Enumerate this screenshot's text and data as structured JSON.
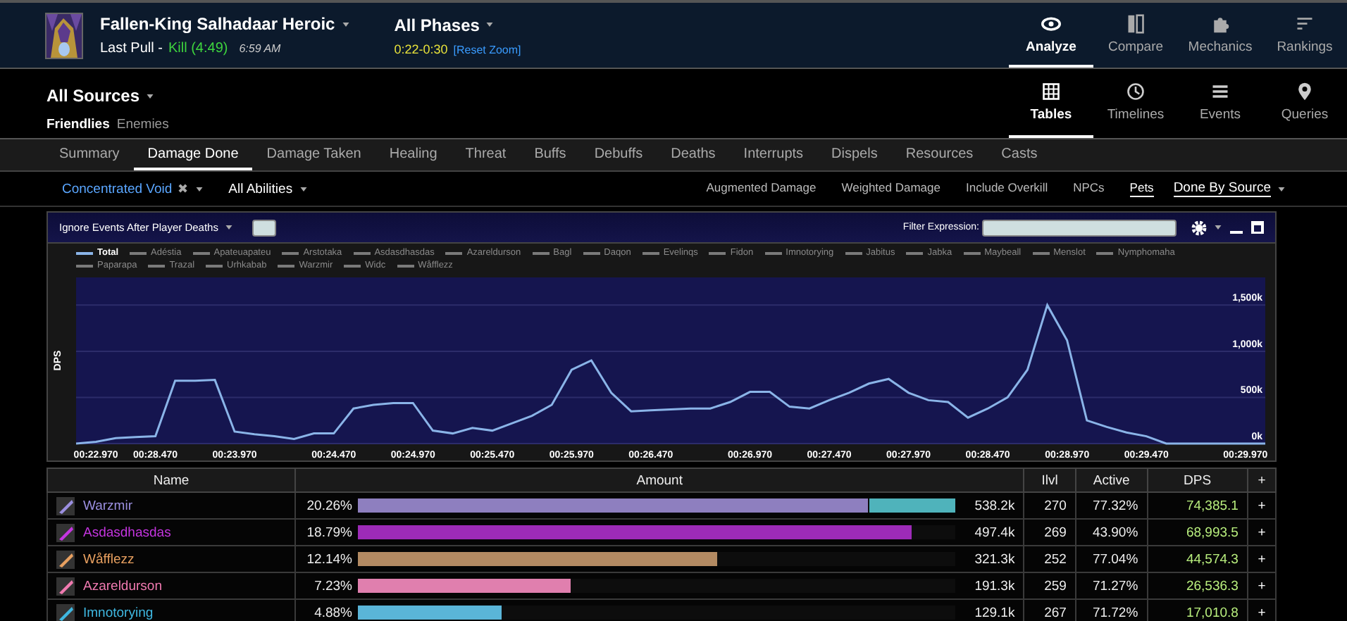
{
  "header": {
    "boss": {
      "title": "Fallen-King Salhadaar Heroic",
      "last_pull": "Last Pull -",
      "result": "Kill (4:49)",
      "time": "6:59 AM"
    },
    "phase": {
      "title": "All Phases",
      "range": "0:22-0:30",
      "reset": "[Reset Zoom]"
    },
    "nav": [
      {
        "label": "Analyze",
        "selected": true
      },
      {
        "label": "Compare",
        "selected": false
      },
      {
        "label": "Mechanics",
        "selected": false
      },
      {
        "label": "Rankings",
        "selected": false
      }
    ]
  },
  "sources": {
    "title": "All Sources",
    "filters": [
      {
        "label": "Friendlies",
        "selected": true
      },
      {
        "label": "Enemies",
        "selected": false
      }
    ],
    "views": [
      {
        "label": "Tables",
        "selected": true
      },
      {
        "label": "Timelines",
        "selected": false
      },
      {
        "label": "Events",
        "selected": false
      },
      {
        "label": "Queries",
        "selected": false
      }
    ]
  },
  "tabs": [
    {
      "label": "Summary",
      "selected": false
    },
    {
      "label": "Damage Done",
      "selected": true
    },
    {
      "label": "Damage Taken",
      "selected": false
    },
    {
      "label": "Healing",
      "selected": false
    },
    {
      "label": "Threat",
      "selected": false
    },
    {
      "label": "Buffs",
      "selected": false
    },
    {
      "label": "Debuffs",
      "selected": false
    },
    {
      "label": "Deaths",
      "selected": false
    },
    {
      "label": "Interrupts",
      "selected": false
    },
    {
      "label": "Dispels",
      "selected": false
    },
    {
      "label": "Resources",
      "selected": false
    },
    {
      "label": "Casts",
      "selected": false
    }
  ],
  "filters": {
    "target": "Concentrated Void",
    "target_clear": "✖",
    "abilities": "All Abilities",
    "toggles": [
      {
        "label": "Augmented Damage",
        "selected": false
      },
      {
        "label": "Weighted Damage",
        "selected": false
      },
      {
        "label": "Include Overkill",
        "selected": false
      },
      {
        "label": "NPCs",
        "selected": false
      },
      {
        "label": "Pets",
        "selected": true
      }
    ],
    "grouping": "Done By Source"
  },
  "graph": {
    "death_option": "Ignore Events After Player Deaths",
    "filter_label": "Filter Expression:",
    "legend": [
      {
        "name": "Adéstia",
        "color": "#7a7a7a"
      },
      {
        "name": "Apateuapateu",
        "color": "#7a7a7a"
      },
      {
        "name": "Arstotaka",
        "color": "#7a7a7a"
      },
      {
        "name": "Asdasdhasdas",
        "color": "#7a7a7a"
      },
      {
        "name": "Azareldurson",
        "color": "#7a7a7a"
      },
      {
        "name": "Bagl",
        "color": "#7a7a7a"
      },
      {
        "name": "Daqon",
        "color": "#7a7a7a"
      },
      {
        "name": "Evelinqs",
        "color": "#7a7a7a"
      },
      {
        "name": "Fidon",
        "color": "#7a7a7a"
      },
      {
        "name": "Imnotorying",
        "color": "#7a7a7a"
      },
      {
        "name": "Jabitus",
        "color": "#7a7a7a"
      },
      {
        "name": "Jabka",
        "color": "#7a7a7a"
      },
      {
        "name": "Maybeall",
        "color": "#7a7a7a"
      },
      {
        "name": "Menslot",
        "color": "#7a7a7a"
      },
      {
        "name": "Nymphomaha",
        "color": "#7a7a7a"
      },
      {
        "name": "Paparapa",
        "color": "#7a7a7a"
      },
      {
        "name": "Trazal",
        "color": "#7a7a7a"
      },
      {
        "name": "Urhkabab",
        "color": "#7a7a7a"
      },
      {
        "name": "Warzmir",
        "color": "#7a7a7a"
      },
      {
        "name": "Widc",
        "color": "#7a7a7a"
      },
      {
        "name": "Wåfflezz",
        "color": "#7a7a7a"
      }
    ],
    "chart_data": {
      "type": "line",
      "ylabel": "DPS",
      "grid": true,
      "ylim": [
        0,
        1800
      ],
      "categories": [
        null,
        "00:22.970",
        null,
        null,
        "00:28.470",
        null,
        null,
        null,
        "00:23.970",
        null,
        null,
        null,
        null,
        "00:24.470",
        null,
        null,
        null,
        "00:24.970",
        null,
        null,
        null,
        "00:25.470",
        null,
        null,
        null,
        "00:25.970",
        null,
        null,
        null,
        "00:26.470",
        null,
        null,
        null,
        null,
        "00:26.970",
        null,
        null,
        null,
        "00:27.470",
        null,
        null,
        null,
        "00:27.970",
        null,
        null,
        null,
        "00:28.470",
        null,
        null,
        null,
        "00:28.970",
        null,
        null,
        null,
        "00:29.470",
        null,
        null,
        null,
        null,
        "00:29.970",
        null
      ],
      "yticks": [
        {
          "value": 0,
          "label": "0k"
        },
        {
          "value": 500,
          "label": "500k"
        },
        {
          "value": 1000,
          "label": "1,000k"
        },
        {
          "value": 1500,
          "label": "1,500k"
        }
      ],
      "series": [
        {
          "name": "Total",
          "color": "#8ab4e8",
          "values": [
            0,
            20,
            60,
            70,
            80,
            680,
            680,
            690,
            130,
            100,
            80,
            50,
            110,
            110,
            380,
            420,
            440,
            440,
            140,
            110,
            170,
            140,
            220,
            300,
            420,
            800,
            900,
            550,
            350,
            360,
            370,
            380,
            380,
            450,
            560,
            560,
            400,
            380,
            470,
            550,
            650,
            700,
            550,
            470,
            450,
            280,
            380,
            500,
            800,
            1500,
            1120,
            250,
            180,
            120,
            80,
            0,
            0,
            0,
            0,
            0,
            0
          ]
        }
      ]
    }
  },
  "table": {
    "columns": [
      "Name",
      "Amount",
      "Ilvl",
      "Active",
      "DPS",
      "+"
    ],
    "rows": [
      {
        "name": "Warzmir",
        "color": "#9b8fe0",
        "percent": "20.26%",
        "segments": [
          {
            "level": 0.854,
            "color": "#8e7fbf"
          },
          {
            "color": "#4fb3bb"
          }
        ],
        "amount": "538.2k",
        "ilvl": "270",
        "active": "77.32%",
        "dps": "74,385.1",
        "more": "+"
      },
      {
        "name": "Asdasdhasdas",
        "color": "#c535e0",
        "percent": "18.79%",
        "segments": [
          {
            "level": 0.926,
            "color": "#9d2bb8"
          }
        ],
        "amount": "497.4k",
        "ilvl": "269",
        "active": "43.90%",
        "dps": "68,993.5",
        "more": "+"
      },
      {
        "name": "Wåfflezz",
        "color": "#e8a060",
        "percent": "12.14%",
        "segments": [
          {
            "level": 0.6,
            "color": "#b38a62"
          }
        ],
        "amount": "321.3k",
        "ilvl": "252",
        "active": "77.04%",
        "dps": "44,574.3",
        "more": "+"
      },
      {
        "name": "Azareldurson",
        "color": "#f07ab0",
        "percent": "7.23%",
        "segments": [
          {
            "level": 0.357,
            "color": "#e07fae"
          }
        ],
        "amount": "191.3k",
        "ilvl": "259",
        "active": "71.27%",
        "dps": "26,536.3",
        "more": "+"
      },
      {
        "name": "Imnotorying",
        "color": "#3fb7e0",
        "percent": "4.88%",
        "segments": [
          {
            "level": 0.24,
            "color": "#5ab5d8"
          }
        ],
        "amount": "129.1k",
        "ilvl": "267",
        "active": "71.72%",
        "dps": "17,010.8",
        "more": "+"
      }
    ]
  }
}
